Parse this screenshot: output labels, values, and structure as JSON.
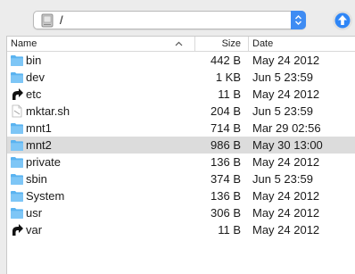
{
  "toolbar": {
    "path": "/",
    "icons": {
      "drive": "hard-drive-icon",
      "stepper": "chevron-updown-icon",
      "up": "arrow-up-icon"
    }
  },
  "columns": {
    "name": "Name",
    "size": "Size",
    "date": "Date"
  },
  "colors": {
    "accent": "#3f8cf3",
    "folder": "#5ab3f0",
    "selected_row": "#dcdcdc"
  },
  "files": [
    {
      "name": "bin",
      "size": "442 B",
      "date": "May 24 2012",
      "kind": "folder"
    },
    {
      "name": "dev",
      "size": "1 KB",
      "date": "Jun 5 23:59",
      "kind": "folder"
    },
    {
      "name": "etc",
      "size": "11 B",
      "date": "May 24 2012",
      "kind": "alias"
    },
    {
      "name": "mktar.sh",
      "size": "204 B",
      "date": "Jun 5 23:59",
      "kind": "file"
    },
    {
      "name": "mnt1",
      "size": "714 B",
      "date": "Mar 29 02:56",
      "kind": "folder"
    },
    {
      "name": "mnt2",
      "size": "986 B",
      "date": "May 30 13:00",
      "kind": "folder",
      "selected": true
    },
    {
      "name": "private",
      "size": "136 B",
      "date": "May 24 2012",
      "kind": "folder"
    },
    {
      "name": "sbin",
      "size": "374 B",
      "date": "Jun 5 23:59",
      "kind": "folder"
    },
    {
      "name": "System",
      "size": "136 B",
      "date": "May 24 2012",
      "kind": "folder"
    },
    {
      "name": "usr",
      "size": "306 B",
      "date": "May 24 2012",
      "kind": "folder"
    },
    {
      "name": "var",
      "size": "11 B",
      "date": "May 24 2012",
      "kind": "alias"
    }
  ]
}
